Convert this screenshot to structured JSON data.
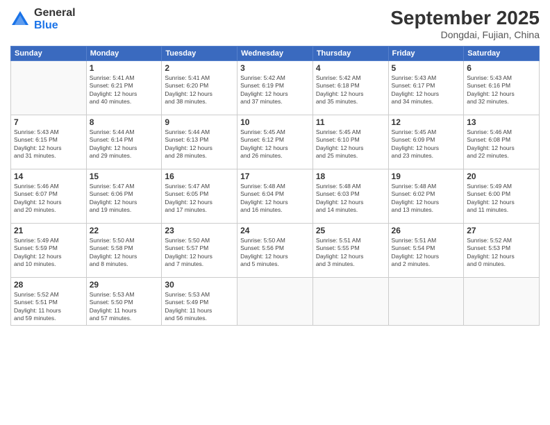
{
  "logo": {
    "general": "General",
    "blue": "Blue"
  },
  "header": {
    "month": "September 2025",
    "location": "Dongdai, Fujian, China"
  },
  "days": {
    "headers": [
      "Sunday",
      "Monday",
      "Tuesday",
      "Wednesday",
      "Thursday",
      "Friday",
      "Saturday"
    ]
  },
  "weeks": [
    [
      {
        "num": "",
        "info": ""
      },
      {
        "num": "1",
        "info": "Sunrise: 5:41 AM\nSunset: 6:21 PM\nDaylight: 12 hours\nand 40 minutes."
      },
      {
        "num": "2",
        "info": "Sunrise: 5:41 AM\nSunset: 6:20 PM\nDaylight: 12 hours\nand 38 minutes."
      },
      {
        "num": "3",
        "info": "Sunrise: 5:42 AM\nSunset: 6:19 PM\nDaylight: 12 hours\nand 37 minutes."
      },
      {
        "num": "4",
        "info": "Sunrise: 5:42 AM\nSunset: 6:18 PM\nDaylight: 12 hours\nand 35 minutes."
      },
      {
        "num": "5",
        "info": "Sunrise: 5:43 AM\nSunset: 6:17 PM\nDaylight: 12 hours\nand 34 minutes."
      },
      {
        "num": "6",
        "info": "Sunrise: 5:43 AM\nSunset: 6:16 PM\nDaylight: 12 hours\nand 32 minutes."
      }
    ],
    [
      {
        "num": "7",
        "info": "Sunrise: 5:43 AM\nSunset: 6:15 PM\nDaylight: 12 hours\nand 31 minutes."
      },
      {
        "num": "8",
        "info": "Sunrise: 5:44 AM\nSunset: 6:14 PM\nDaylight: 12 hours\nand 29 minutes."
      },
      {
        "num": "9",
        "info": "Sunrise: 5:44 AM\nSunset: 6:13 PM\nDaylight: 12 hours\nand 28 minutes."
      },
      {
        "num": "10",
        "info": "Sunrise: 5:45 AM\nSunset: 6:12 PM\nDaylight: 12 hours\nand 26 minutes."
      },
      {
        "num": "11",
        "info": "Sunrise: 5:45 AM\nSunset: 6:10 PM\nDaylight: 12 hours\nand 25 minutes."
      },
      {
        "num": "12",
        "info": "Sunrise: 5:45 AM\nSunset: 6:09 PM\nDaylight: 12 hours\nand 23 minutes."
      },
      {
        "num": "13",
        "info": "Sunrise: 5:46 AM\nSunset: 6:08 PM\nDaylight: 12 hours\nand 22 minutes."
      }
    ],
    [
      {
        "num": "14",
        "info": "Sunrise: 5:46 AM\nSunset: 6:07 PM\nDaylight: 12 hours\nand 20 minutes."
      },
      {
        "num": "15",
        "info": "Sunrise: 5:47 AM\nSunset: 6:06 PM\nDaylight: 12 hours\nand 19 minutes."
      },
      {
        "num": "16",
        "info": "Sunrise: 5:47 AM\nSunset: 6:05 PM\nDaylight: 12 hours\nand 17 minutes."
      },
      {
        "num": "17",
        "info": "Sunrise: 5:48 AM\nSunset: 6:04 PM\nDaylight: 12 hours\nand 16 minutes."
      },
      {
        "num": "18",
        "info": "Sunrise: 5:48 AM\nSunset: 6:03 PM\nDaylight: 12 hours\nand 14 minutes."
      },
      {
        "num": "19",
        "info": "Sunrise: 5:48 AM\nSunset: 6:02 PM\nDaylight: 12 hours\nand 13 minutes."
      },
      {
        "num": "20",
        "info": "Sunrise: 5:49 AM\nSunset: 6:00 PM\nDaylight: 12 hours\nand 11 minutes."
      }
    ],
    [
      {
        "num": "21",
        "info": "Sunrise: 5:49 AM\nSunset: 5:59 PM\nDaylight: 12 hours\nand 10 minutes."
      },
      {
        "num": "22",
        "info": "Sunrise: 5:50 AM\nSunset: 5:58 PM\nDaylight: 12 hours\nand 8 minutes."
      },
      {
        "num": "23",
        "info": "Sunrise: 5:50 AM\nSunset: 5:57 PM\nDaylight: 12 hours\nand 7 minutes."
      },
      {
        "num": "24",
        "info": "Sunrise: 5:50 AM\nSunset: 5:56 PM\nDaylight: 12 hours\nand 5 minutes."
      },
      {
        "num": "25",
        "info": "Sunrise: 5:51 AM\nSunset: 5:55 PM\nDaylight: 12 hours\nand 3 minutes."
      },
      {
        "num": "26",
        "info": "Sunrise: 5:51 AM\nSunset: 5:54 PM\nDaylight: 12 hours\nand 2 minutes."
      },
      {
        "num": "27",
        "info": "Sunrise: 5:52 AM\nSunset: 5:53 PM\nDaylight: 12 hours\nand 0 minutes."
      }
    ],
    [
      {
        "num": "28",
        "info": "Sunrise: 5:52 AM\nSunset: 5:51 PM\nDaylight: 11 hours\nand 59 minutes."
      },
      {
        "num": "29",
        "info": "Sunrise: 5:53 AM\nSunset: 5:50 PM\nDaylight: 11 hours\nand 57 minutes."
      },
      {
        "num": "30",
        "info": "Sunrise: 5:53 AM\nSunset: 5:49 PM\nDaylight: 11 hours\nand 56 minutes."
      },
      {
        "num": "",
        "info": ""
      },
      {
        "num": "",
        "info": ""
      },
      {
        "num": "",
        "info": ""
      },
      {
        "num": "",
        "info": ""
      }
    ]
  ]
}
